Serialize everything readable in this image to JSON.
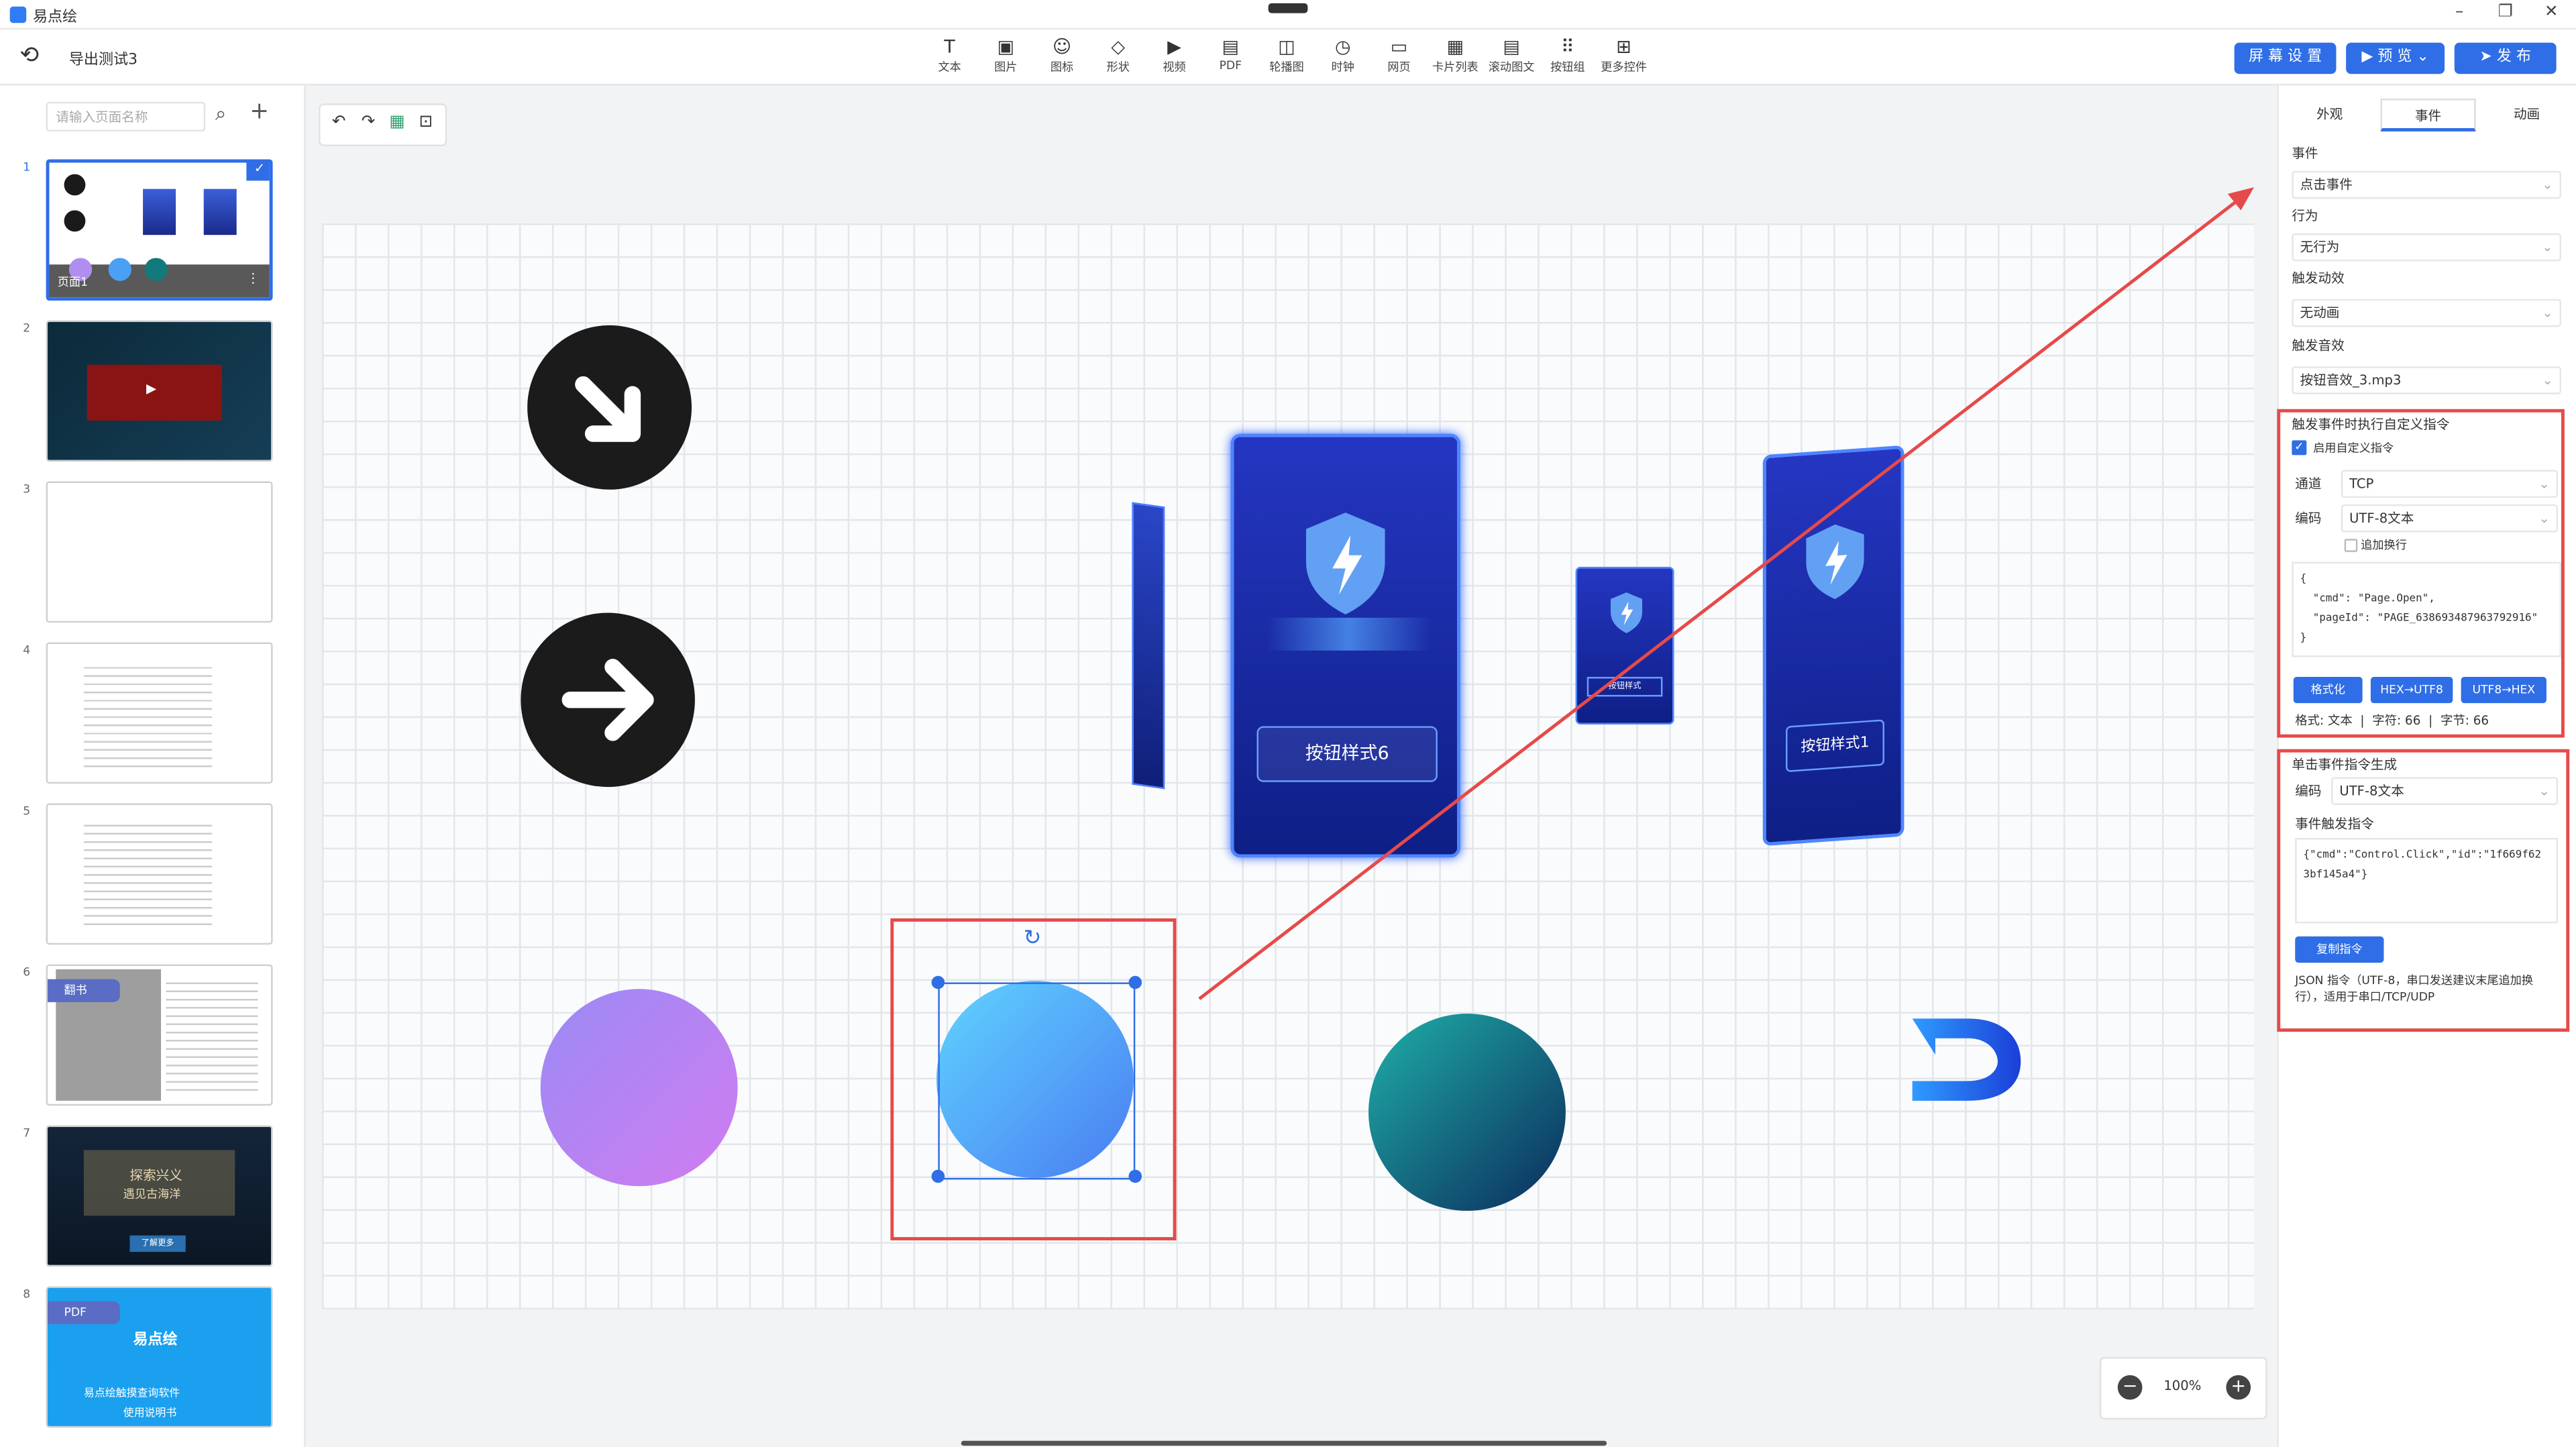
{
  "app": {
    "name": "易点绘"
  },
  "window": {
    "minimize": "–",
    "restore": "❐",
    "close": "✕"
  },
  "toolbar": {
    "doc_title": "导出测试3",
    "tools": [
      {
        "label": "文本",
        "icon": "T"
      },
      {
        "label": "图片",
        "icon": "▣"
      },
      {
        "label": "图标",
        "icon": "☺"
      },
      {
        "label": "形状",
        "icon": "◇"
      },
      {
        "label": "视频",
        "icon": "▶"
      },
      {
        "label": "PDF",
        "icon": "▤"
      },
      {
        "label": "轮播图",
        "icon": "◫"
      },
      {
        "label": "时钟",
        "icon": "◷"
      },
      {
        "label": "网页",
        "icon": "▭"
      },
      {
        "label": "卡片列表",
        "icon": "▦"
      },
      {
        "label": "滚动图文",
        "icon": "▤"
      },
      {
        "label": "按钮组",
        "icon": "⠿"
      },
      {
        "label": "更多控件",
        "icon": "⊞"
      }
    ],
    "screen_settings": "屏 幕 设 置",
    "preview": "▶ 预 览  ⌄",
    "publish": "➤ 发 布"
  },
  "left_panel": {
    "search_placeholder": "请输入页面名称",
    "pages": [
      {
        "num": "1",
        "label": "页面1"
      },
      {
        "num": "2"
      },
      {
        "num": "3"
      },
      {
        "num": "4"
      },
      {
        "num": "5"
      },
      {
        "num": "6",
        "badge": "翻书"
      },
      {
        "num": "7",
        "text1": "探索兴义",
        "text2": "遇见古海洋",
        "btn": "了解更多"
      },
      {
        "num": "8",
        "badge": "PDF",
        "logo": "易点绘",
        "text1": "易点绘触摸查询软件",
        "text2": "使用说明书"
      }
    ]
  },
  "canvas": {
    "zoom": "100%",
    "card_labels": [
      "按钮样式6",
      "按钮样式1",
      "按钮样式"
    ]
  },
  "right_panel": {
    "tabs": [
      "外观",
      "事件",
      "动画"
    ],
    "event_label": "事件",
    "event_value": "点击事件",
    "action_label": "行为",
    "action_value": "无行为",
    "effect_label": "触发动效",
    "effect_value": "无动画",
    "sound_label": "触发音效",
    "sound_value": "按钮音效_3.mp3",
    "custom": {
      "title": "触发事件时执行自定义指令",
      "enable_label": "启用自定义指令",
      "channel_label": "通道",
      "channel_value": "TCP",
      "encoding_label": "编码",
      "encoding_value": "UTF-8文本",
      "newline_label": "追加换行",
      "code": "{\n  \"cmd\": \"Page.Open\",\n  \"pageId\": \"PAGE_638693487963792916\"\n}",
      "btn_format": "格式化",
      "btn_hex_utf8": "HEX→UTF8",
      "btn_utf8_hex": "UTF8→HEX",
      "stats": "格式: 文本  |  字符: 66  |  字节: 66"
    },
    "gen": {
      "title": "单击事件指令生成",
      "encoding_label": "编码",
      "encoding_value": "UTF-8文本",
      "cmd_label": "事件触发指令",
      "cmd_value": "{\"cmd\":\"Control.Click\",\"id\":\"1f669f62\n3bf145a4\"}",
      "copy_btn": "复制指令",
      "note": "JSON 指令（UTF-8，串口发送建议末尾追加换\n行），适用于串口/TCP/UDP"
    }
  },
  "colors": {
    "accent": "#2f6ee6",
    "highlight": "#e64a4a"
  }
}
